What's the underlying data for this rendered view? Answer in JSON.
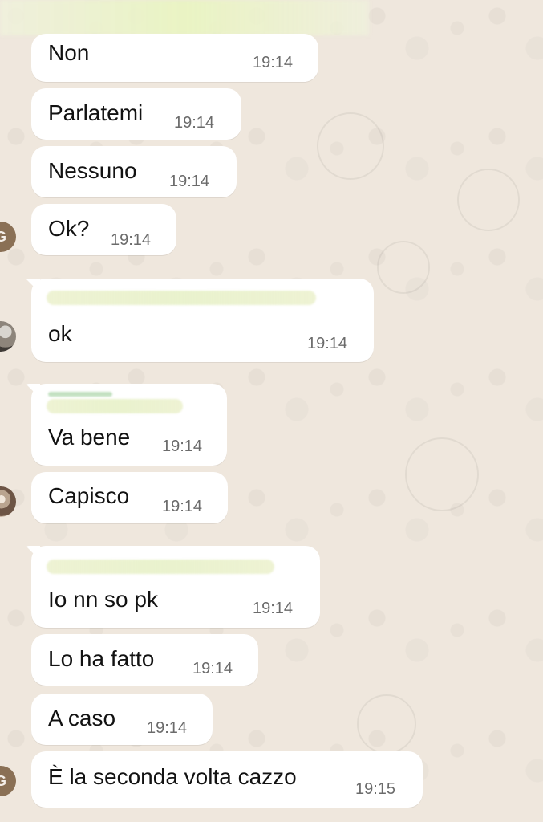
{
  "chat": {
    "messages": [
      {
        "text": "Non",
        "time": "19:14"
      },
      {
        "text": "Parlatemi",
        "time": "19:14"
      },
      {
        "text": "Nessuno",
        "time": "19:14"
      },
      {
        "text": "Ok?",
        "time": "19:14"
      },
      {
        "text": "ok",
        "time": "19:14"
      },
      {
        "text": "Va bene",
        "time": "19:14"
      },
      {
        "text": "Capisco",
        "time": "19:14"
      },
      {
        "text": "Io nn so pk",
        "time": "19:14"
      },
      {
        "text": "Lo ha fatto",
        "time": "19:14"
      },
      {
        "text": "A caso",
        "time": "19:14"
      },
      {
        "text": "È la seconda volta cazzo",
        "time": "19:15"
      }
    ],
    "avatars": {
      "g_initial": "G"
    }
  },
  "colors": {
    "background": "#efe7dd",
    "bubble": "#ffffff",
    "text": "#121212",
    "time": "#6b6b6b"
  }
}
